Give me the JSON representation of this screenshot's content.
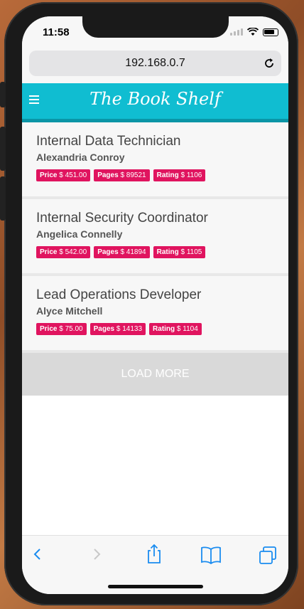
{
  "status": {
    "time": "11:58"
  },
  "browser": {
    "url": "192.168.0.7"
  },
  "app": {
    "title": "The Book Shelf"
  },
  "books": [
    {
      "title": "Internal Data Technician",
      "author": "Alexandria Conroy",
      "price_label": "Price",
      "price_value": "$ 451.00",
      "pages_label": "Pages",
      "pages_value": "$ 89521",
      "rating_label": "Rating",
      "rating_value": "$ 1106"
    },
    {
      "title": "Internal Security Coordinator",
      "author": "Angelica Connelly",
      "price_label": "Price",
      "price_value": "$ 542.00",
      "pages_label": "Pages",
      "pages_value": "$ 41894",
      "rating_label": "Rating",
      "rating_value": "$ 1105"
    },
    {
      "title": "Lead Operations Developer",
      "author": "Alyce Mitchell",
      "price_label": "Price",
      "price_value": "$ 75.00",
      "pages_label": "Pages",
      "pages_value": "$ 14133",
      "rating_label": "Rating",
      "rating_value": "$ 1104"
    }
  ],
  "load_more_label": "LOAD MORE",
  "colors": {
    "appbar": "#10bdd1",
    "tag": "#e0145f",
    "ios_blue": "#1a8cf0"
  },
  "toolbar_icons": [
    "back-icon",
    "forward-icon",
    "share-icon",
    "bookmarks-icon",
    "tabs-icon"
  ]
}
